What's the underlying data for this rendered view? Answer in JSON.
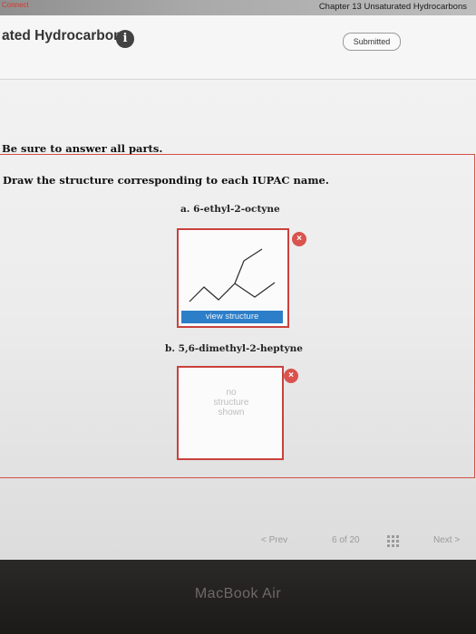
{
  "topbar": {
    "brand": "Connect",
    "chapter": "Chapter 13 Unsaturated Hydrocarbons"
  },
  "header": {
    "assignment_title": "ated Hydrocarbons",
    "info_glyph": "i",
    "status": "Submitted"
  },
  "question": {
    "instruction": "Be sure to answer all parts.",
    "prompt": "Draw the structure corresponding to each IUPAC name.",
    "parts": [
      {
        "label": "a. 6-ethyl-2-octyne",
        "delete_glyph": "×",
        "view_button": "view structure"
      },
      {
        "label": "b. 5,6-dimethyl-2-heptyne",
        "delete_glyph": "×",
        "empty_text_lines": [
          "no",
          "structure",
          "shown"
        ]
      }
    ]
  },
  "navigation": {
    "prev": "< Prev",
    "page_current": "6",
    "page_sep": "of",
    "page_total": "20",
    "next": "Next >"
  },
  "icons": {
    "info": "info-icon",
    "delete": "delete-icon",
    "grid": "grid-icon"
  },
  "colors": {
    "accent_red": "#d44d48",
    "button_blue": "#2c7ec8"
  },
  "bezel": {
    "label": "MacBook Air"
  }
}
